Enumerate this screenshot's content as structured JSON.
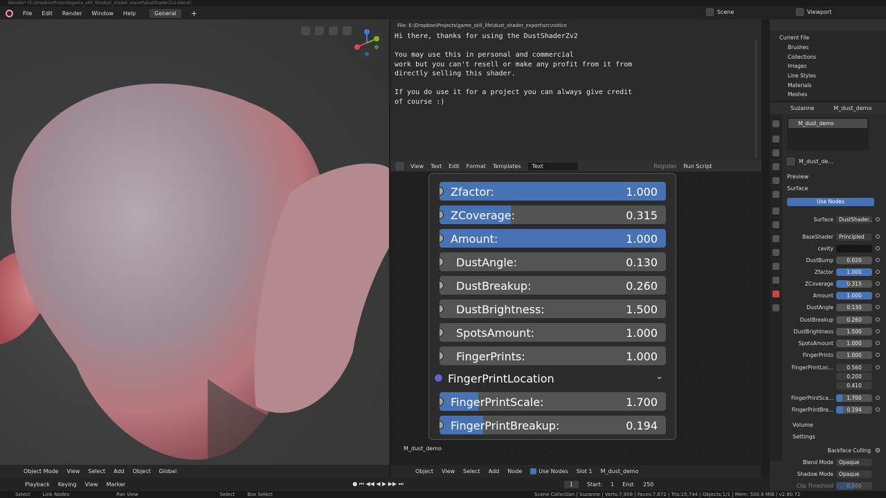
{
  "titlebar": "Blender* [E:\\Dropbox\\Projects\\game_still_life\\dust_shader_export\\dustShaderZv2.blend]",
  "menu": {
    "file": "File",
    "edit": "Edit",
    "render": "Render",
    "window": "Window",
    "help": "Help",
    "workspace": "General"
  },
  "scene": "Scene",
  "view_layer": "Viewport",
  "text_editor": {
    "file_path": "File: E:\\Dropbox\\Projects\\game_still_life\\dust_shader_export\\src\\notice",
    "content": "Hi there, thanks for using the DustShaderZv2\n\nYou may use this in personal and commercial\nwork but you can't resell or make any profit from it from\ndirectly selling this shader.\n\nIf you do use it for a project you can always give credit\nof course :)",
    "header": {
      "view": "View",
      "text": "Text",
      "edit": "Edit",
      "format": "Format",
      "templates": "Templates",
      "datablock": "Text",
      "register": "Register",
      "run_script": "Run Script"
    }
  },
  "node": {
    "rows": [
      {
        "label": "Zfactor:",
        "value": "1.000",
        "fill": 1.0
      },
      {
        "label": "ZCoverage:",
        "value": "0.315",
        "fill": 0.315
      },
      {
        "label": "Amount:",
        "value": "1.000",
        "fill": 1.0
      },
      {
        "label": "DustAngle:",
        "value": "0.130",
        "fill": 0
      },
      {
        "label": "DustBreakup:",
        "value": "0.260",
        "fill": 0
      },
      {
        "label": "DustBrightness:",
        "value": "1.500",
        "fill": 0
      },
      {
        "label": "SpotsAmount:",
        "value": "1.000",
        "fill": 0
      },
      {
        "label": "FingerPrints:",
        "value": "1.000",
        "fill": 0
      },
      {
        "label": "FingerPrintLocation",
        "value": "",
        "fill": 0
      },
      {
        "label": "FingerPrintScale:",
        "value": "1.700",
        "fill": 0.17
      },
      {
        "label": "FingerPrintBreakup:",
        "value": "0.194",
        "fill": 0.194
      }
    ],
    "material_label": "M_dust_demo"
  },
  "viewport_header": {
    "mode": "Object Mode",
    "view": "View",
    "select": "Select",
    "add": "Add",
    "object": "Object",
    "orientation": "Global"
  },
  "node_header": {
    "type": "Object",
    "view": "View",
    "select": "Select",
    "add": "Add",
    "node": "Node",
    "use_nodes": "Use Nodes",
    "slot": "Slot 1",
    "material": "M_dust_demo"
  },
  "timeline": {
    "playback": "Playback",
    "keying": "Keying",
    "view": "View",
    "marker": "Marker",
    "frame": "1",
    "start_label": "Start:",
    "start": "1",
    "end_label": "End:",
    "end": "250"
  },
  "status": {
    "select": "Select",
    "link": "Link Nodes",
    "pan": "Pan View",
    "select2": "Select",
    "box": "Box Select",
    "stats": "Scene Collection | Suzanne | Verts:7,958 | Faces:7,872 | Tris:15,744 | Objects:1/1 | Mem: 500.8 MiB | v2.80.72"
  },
  "outliner": {
    "title": "Current File",
    "items": [
      "Brushes",
      "Collections",
      "Images",
      "Line Styles",
      "Materials",
      "Meshes"
    ]
  },
  "properties": {
    "object": "Suzanne",
    "material": "M_dust_demo",
    "slot": "M_dust_demo",
    "mat_short": "M_dust_de...",
    "preview": "Preview",
    "surface": "Surface",
    "use_nodes": "Use Nodes",
    "surface_label": "Surface",
    "surface_value": "DustShader...",
    "base_label": "BaseShader",
    "base_value": "Principled B...",
    "fields": [
      {
        "label": "cavity",
        "value": ""
      },
      {
        "label": "DustBump",
        "value": "0.020"
      },
      {
        "label": "Zfactor",
        "value": "1.000"
      },
      {
        "label": "ZCoverage",
        "value": "0.315"
      },
      {
        "label": "Amount",
        "value": "1.000"
      },
      {
        "label": "DustAngle",
        "value": "0.130"
      },
      {
        "label": "DustBreakup",
        "value": "0.260"
      },
      {
        "label": "DustBrightness",
        "value": "1.500"
      },
      {
        "label": "SpotsAmount",
        "value": "1.000"
      },
      {
        "label": "FingerPrints",
        "value": "1.000"
      },
      {
        "label": "FingerPrintLoc...",
        "value": "0.560"
      },
      {
        "label": "",
        "value": "0.200"
      },
      {
        "label": "",
        "value": "0.410"
      },
      {
        "label": "FingerPrintSca...",
        "value": "1.700"
      },
      {
        "label": "FingerPrintBre...",
        "value": "0.194"
      }
    ],
    "volume": "Volume",
    "settings": "Settings",
    "backface": "Backface Culling",
    "blend_label": "Blend Mode",
    "blend_value": "Opaque",
    "shadow_label": "Shadow Mode",
    "shadow_value": "Opaque",
    "clip_label": "Clip Threshold",
    "clip_value": "0.500"
  }
}
